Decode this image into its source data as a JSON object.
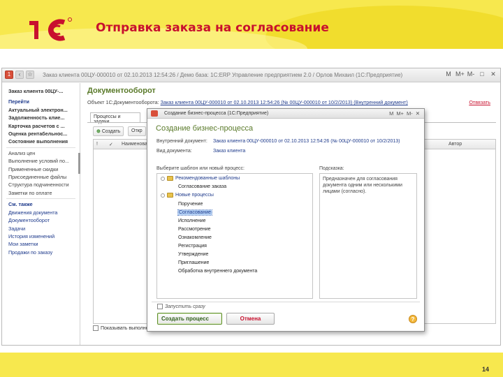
{
  "slide": {
    "title": "Отправка заказа на согласование",
    "logo_text": "1С",
    "page_number": "14",
    "brand_color": "#c8102e",
    "header_color": "#f7e84e"
  },
  "window": {
    "title": "Заказ клиента 00ЦУ-000010 от 02.10.2013 12:54:26 / Демо база: 1С:ERP Управление предприятием 2.0 / Орлов Михаил (1С:Предприятие)",
    "controls": [
      "M",
      "M+",
      "M-",
      "□",
      "✕"
    ]
  },
  "sidebar": {
    "header": "Заказ клиента 00ЦУ-...",
    "group1": [
      "Перейти",
      "Актуальный электрон...",
      "Задолженность клие...",
      "Карточка расчетов с ...",
      "Оценка рентабельнос...",
      "Состояние выполнения"
    ],
    "group2": [
      "Анализ цен",
      "Выполнение условий по...",
      "Примененные скидки",
      "Присоединенные файлы",
      "Структура подчиненности",
      "Заметки по оплате"
    ],
    "group3_header": "См. также",
    "group3": [
      "Движения документа",
      "Документооборот",
      "Задачи",
      "История изменений",
      "Мои заметки",
      "Продажи по заказу"
    ]
  },
  "doc": {
    "heading": "Документооборот",
    "object_label": "Объект 1С:Документооборота:",
    "object_link": "Заказ клиента 00ЦУ-000010 от 02.10.2013 12:54:26 (№ 00ЦУ-000010 от 10/2/2013) (Внутренний документ)",
    "close_link": "Отвязать",
    "tab": "Процессы и задачи",
    "btn_create": "Создать",
    "btn_open": "Откр",
    "col_name": "Наименование",
    "col_author": "Автор",
    "show_completed": "Показывать выполне"
  },
  "dialog": {
    "title": "Создание бизнес-процесса (1С:Предприятие)",
    "title_controls": [
      "M",
      "M+",
      "M-",
      "✕"
    ],
    "heading": "Создание бизнес-процесса",
    "doc_label": "Внутренний документ:",
    "doc_value": "Заказ клиента 00ЦУ-000010 от 02.10.2013 12:54:26 (№ 00ЦУ-000010 от 10/2/2013)",
    "doctype_label": "Вид документа:",
    "doctype_value": "Заказ клиента",
    "choose_label": "Выберите шаблон или новый процесс:",
    "hint_label": "Подсказка:",
    "hint_text": "Предназначен для согласования документа одним или несколькими лицами (согласно).",
    "tree": {
      "group_recommended": "Рекомендованные шаблоны",
      "template_sogl": "Согласование заказа",
      "group_new": "Новые процессы",
      "items": [
        "Поручение",
        "Согласование",
        "Исполнение",
        "Рассмотрение",
        "Ознакомление",
        "Регистрация",
        "Утверждение",
        "Приглашение",
        "Обработка внутреннего документа"
      ],
      "selected_index": 1
    },
    "run_label": "Запустить сразу",
    "btn_create": "Создать процесс",
    "btn_cancel": "Отмена",
    "help": "?"
  }
}
